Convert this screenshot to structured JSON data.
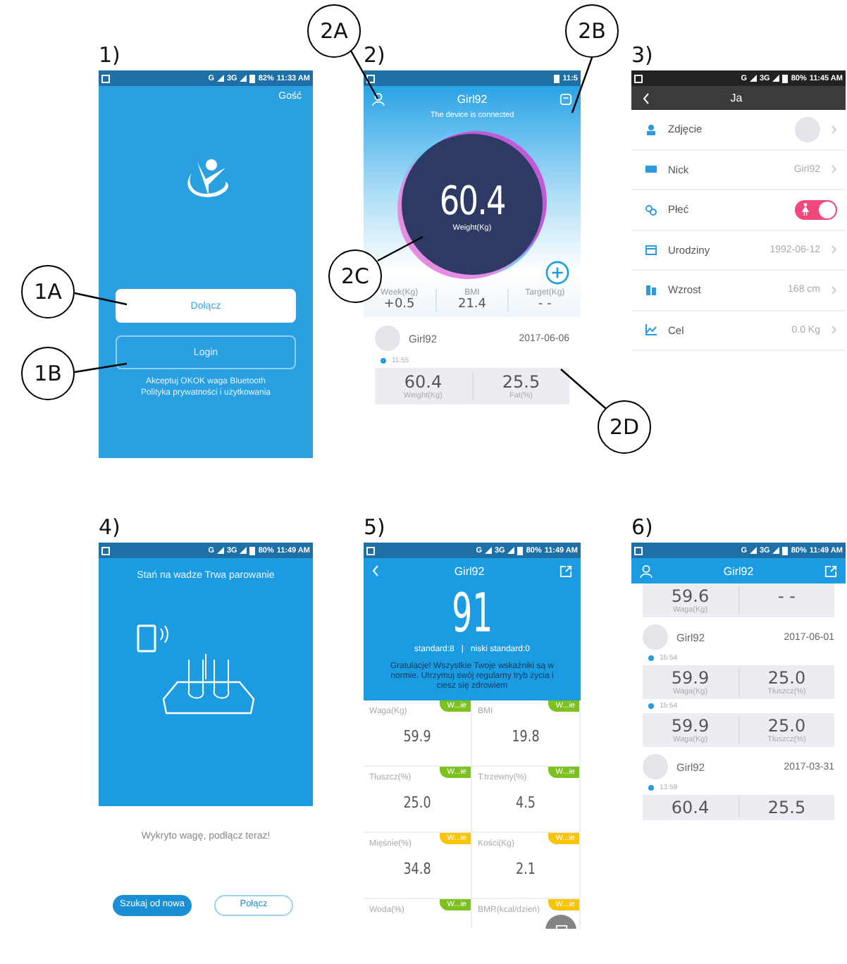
{
  "screens": [
    {
      "kind": "login",
      "label": "1)",
      "status": {
        "network": [
          "G",
          "3G"
        ],
        "battery": "82%",
        "time": "11:33 AM"
      },
      "guest": "Gość",
      "buttons": [
        {
          "label": "Dołącz",
          "kind": "filled"
        },
        {
          "label": "Login",
          "kind": "outline"
        }
      ],
      "terms": [
        "Akceptuj OKOK waga Bluetooth",
        "Polityka prywatności i użytkowania"
      ]
    },
    {
      "kind": "home",
      "label": "2)",
      "status": {
        "time": "11:5"
      },
      "title": "Girl92",
      "connected": "The device is connected",
      "weight": "60.4",
      "weight_label": "Weight(Kg)",
      "stats": [
        {
          "label": "Week(Kg)",
          "value": "+0.5"
        },
        {
          "label": "BMI",
          "value": "21.4"
        },
        {
          "label": "Target(Kg)",
          "value": "- -"
        }
      ],
      "record": {
        "user": "Girl92",
        "date": "2017-06-06",
        "time": "11:55",
        "values": [
          {
            "value": "60.4",
            "label": "Weight(Kg)"
          },
          {
            "value": "25.5",
            "label": "Fat(%)"
          }
        ]
      }
    },
    {
      "kind": "profile",
      "label": "3)",
      "status": {
        "network": [
          "G",
          "3G"
        ],
        "battery": "80%",
        "time": "11:45 AM"
      },
      "title": "Ja",
      "rows": [
        {
          "kind": "avatar",
          "label": "Zdjęcie"
        },
        {
          "kind": "text",
          "label": "Nick",
          "value": "Girl92"
        },
        {
          "kind": "toggle",
          "label": "Płeć",
          "on": true
        },
        {
          "kind": "text",
          "label": "Urodziny",
          "value": "1992-06-12"
        },
        {
          "kind": "text",
          "label": "Wzrost",
          "value": "168 cm"
        },
        {
          "kind": "text",
          "label": "Cel",
          "value": "0.0 Kg"
        }
      ]
    },
    {
      "kind": "pairing",
      "label": "4)",
      "status": {
        "network": [
          "G",
          "3G"
        ],
        "battery": "80%",
        "time": "11:49 AM"
      },
      "title": "Stań na wadze Trwa parowanie",
      "message": "Wykryto wagę, podłącz teraz!",
      "buttons": [
        {
          "label": "Szukaj od nowa",
          "kind": "filled"
        },
        {
          "label": "Połącz",
          "kind": "outline"
        }
      ]
    },
    {
      "kind": "report",
      "label": "5)",
      "status": {
        "network": [
          "G",
          "3G"
        ],
        "battery": "80%",
        "time": "11:49 AM"
      },
      "title": "Girl92",
      "score": "91",
      "standard": "standard:8",
      "separator": "|",
      "low_standard": "niski standard:0",
      "message": "Gratulacje! Wszystkie Twoje wskaźniki są w normie. Utrzymuj swój regularny tryb życia i ciesz się zdrowiem",
      "metrics": [
        {
          "label": "Waga(Kg)",
          "value": "59.9",
          "badge": "W...ie",
          "color": "#7dc11f"
        },
        {
          "label": "BMI",
          "value": "19.8",
          "badge": "W...ie",
          "color": "#7dc11f"
        },
        {
          "label": "Tłuszcz(%)",
          "value": "25.0",
          "badge": "W...ie",
          "color": "#7dc11f"
        },
        {
          "label": "T.trzewny(%)",
          "value": "4.5",
          "badge": "W...ie",
          "color": "#7dc11f"
        },
        {
          "label": "Mięśnie(%)",
          "value": "34.8",
          "badge": "W...ie",
          "color": "#f7c600"
        },
        {
          "label": "Kości(Kg)",
          "value": "2.1",
          "badge": "W...ie",
          "color": "#f7c600"
        },
        {
          "label": "Woda(%)",
          "badge": "W...ie",
          "color": "#7dc11f"
        },
        {
          "label": "BMR(kcal/dzień)",
          "badge": "W...ie",
          "color": "#f7c600"
        }
      ]
    },
    {
      "kind": "history",
      "label": "6)",
      "status": {
        "network": [
          "G",
          "3G"
        ],
        "battery": "80%",
        "time": "11:49 AM"
      },
      "title": "Girl92",
      "entries": [
        {
          "kind": "card",
          "values": [
            {
              "value": "59.6",
              "label": "Waga(Kg)"
            },
            {
              "value": "- -"
            }
          ]
        },
        {
          "kind": "user",
          "name": "Girl92",
          "date": "2017-06-01"
        },
        {
          "kind": "time",
          "time": "15:54"
        },
        {
          "kind": "card",
          "values": [
            {
              "value": "59.9",
              "label": "Waga(Kg)"
            },
            {
              "value": "25.0",
              "label": "Tłuszcz(%)"
            }
          ]
        },
        {
          "kind": "time",
          "time": "15:54"
        },
        {
          "kind": "card",
          "values": [
            {
              "value": "59.9",
              "label": "Waga(Kg)"
            },
            {
              "value": "25.0",
              "label": "Tłuszcz(%)"
            }
          ]
        },
        {
          "kind": "user",
          "name": "Girl92",
          "date": "2017-03-31"
        },
        {
          "kind": "time",
          "time": "13:59"
        },
        {
          "kind": "card",
          "values": [
            {
              "value": "60.4"
            },
            {
              "value": "25.5"
            }
          ]
        }
      ]
    }
  ],
  "callouts": [
    {
      "label": "1A"
    },
    {
      "label": "1B"
    },
    {
      "label": "2A"
    },
    {
      "label": "2B"
    },
    {
      "label": "2C"
    },
    {
      "label": "2D"
    }
  ]
}
